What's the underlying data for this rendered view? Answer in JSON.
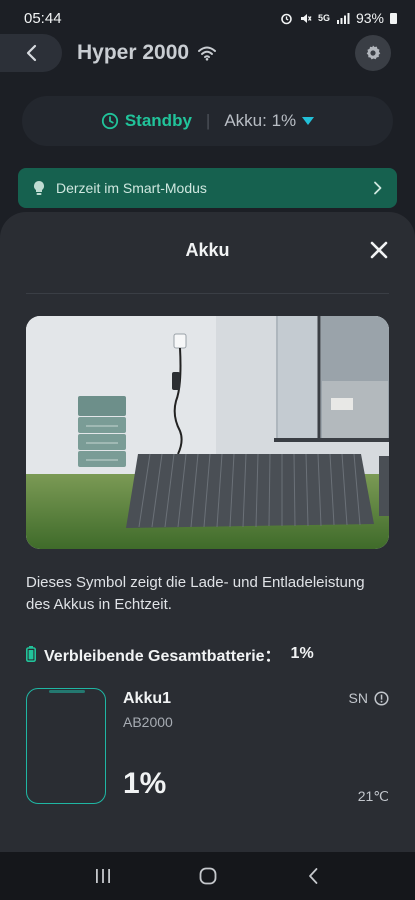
{
  "status_bar": {
    "time": "05:44",
    "battery_percent": "93%",
    "network": "5G"
  },
  "app": {
    "title": "Hyper 2000",
    "icons": {
      "back": "chevron-left-icon",
      "wifi": "wifi-icon",
      "settings": "gear-icon"
    }
  },
  "status_card": {
    "state": "Standby",
    "battery_label": "Akku: 1%"
  },
  "smart_banner": {
    "label": "Derzeit im Smart-Modus"
  },
  "sheet": {
    "title": "Akku",
    "description": "Dieses Symbol zeigt die Lade- und Entladeleistung des Akkus in Echtzeit.",
    "total_label": "Verbleibende Gesamtbatterie：",
    "total_value": "1%",
    "battery": {
      "name": "Akku1",
      "model": "AB2000",
      "level": "1%",
      "sn_label": "SN",
      "temperature": "21℃",
      "level_fraction": 0.01
    }
  },
  "colors": {
    "accent": "#21c39a",
    "banner": "#16614f",
    "battery_border": "#1fb6a3",
    "background": "#1c1f25",
    "sheet": "#2a2d33"
  }
}
